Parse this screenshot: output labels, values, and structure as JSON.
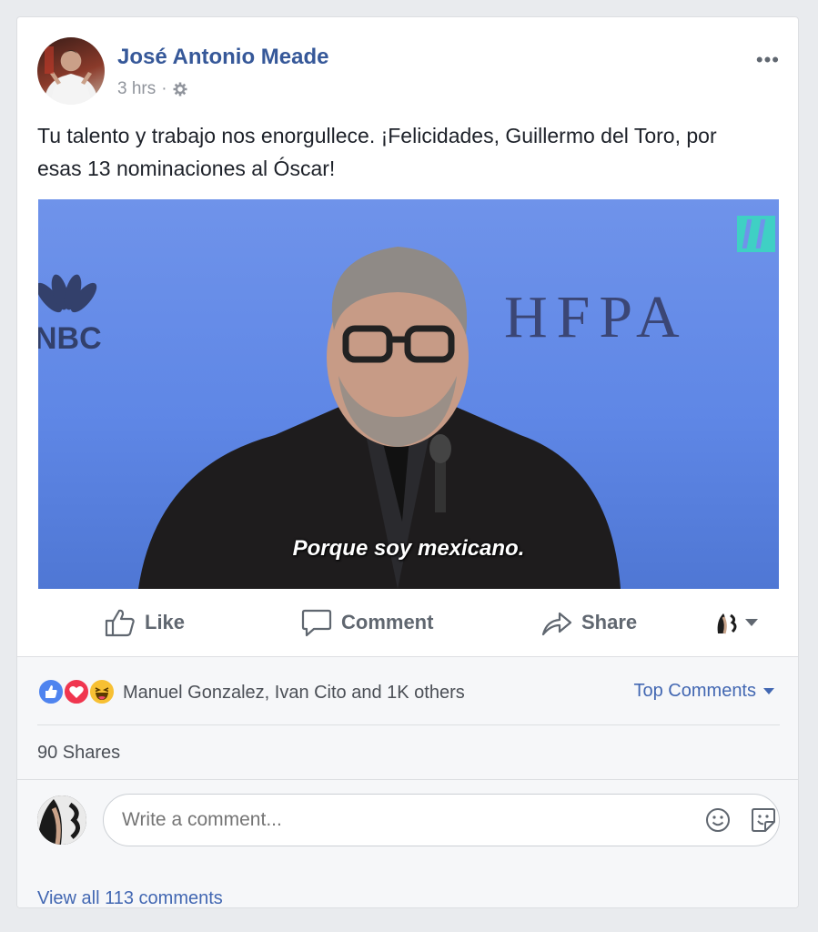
{
  "post": {
    "author": "José Antonio Meade",
    "time": "3 hrs",
    "separator": "·",
    "text": "Tu talento y trabajo nos enorgullece. ¡Felicidades, Guillermo del Toro, por esas 13 nominaciones al Óscar!",
    "more": "•••"
  },
  "media": {
    "logo_text": "NBC",
    "banner_text": "HFPA",
    "subtitle": "Porque soy mexicano."
  },
  "actions": {
    "like": "Like",
    "comment": "Comment",
    "share": "Share"
  },
  "stats": {
    "reactions": [
      "like-icon",
      "love-icon",
      "haha-icon"
    ],
    "reactors": "Manuel Gonzalez, Ivan Cito and 1K others",
    "sort_label": "Top Comments",
    "shares": "90 Shares"
  },
  "comments": {
    "placeholder": "Write a comment...",
    "view_all": "View all 113 comments"
  },
  "colors": {
    "link": "#365899",
    "action_link": "#4267b2",
    "media_bg": "#6f93ea"
  }
}
